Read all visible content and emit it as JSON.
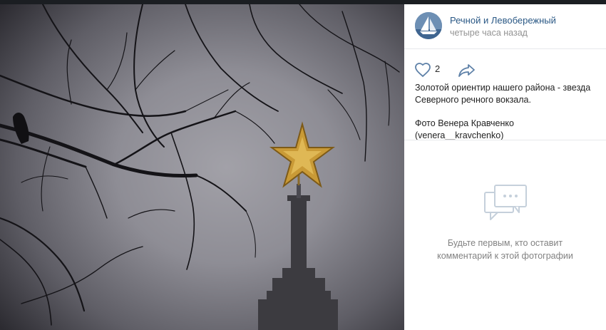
{
  "post": {
    "group_name": "Речной и Левобережный",
    "time": "четыре часа назад",
    "likes": "2",
    "caption_line1": "Золотой ориентир нашего района - звезда Северного речного вокзала.",
    "caption_line2": "Фото Венера Кравченко (venera__kravchenko)"
  },
  "comments": {
    "empty_line1": "Будьте первым, кто оставит",
    "empty_line2": "комментарий к этой фотографии"
  },
  "icons": {
    "avatar": "sailboat-logo",
    "like": "heart-icon",
    "share": "share-arrow-icon",
    "empty": "comment-bubble-icon"
  },
  "colors": {
    "link": "#2a5885",
    "muted": "#939393",
    "icon": "#5e81a8",
    "empty_icon": "#c5d0db"
  }
}
